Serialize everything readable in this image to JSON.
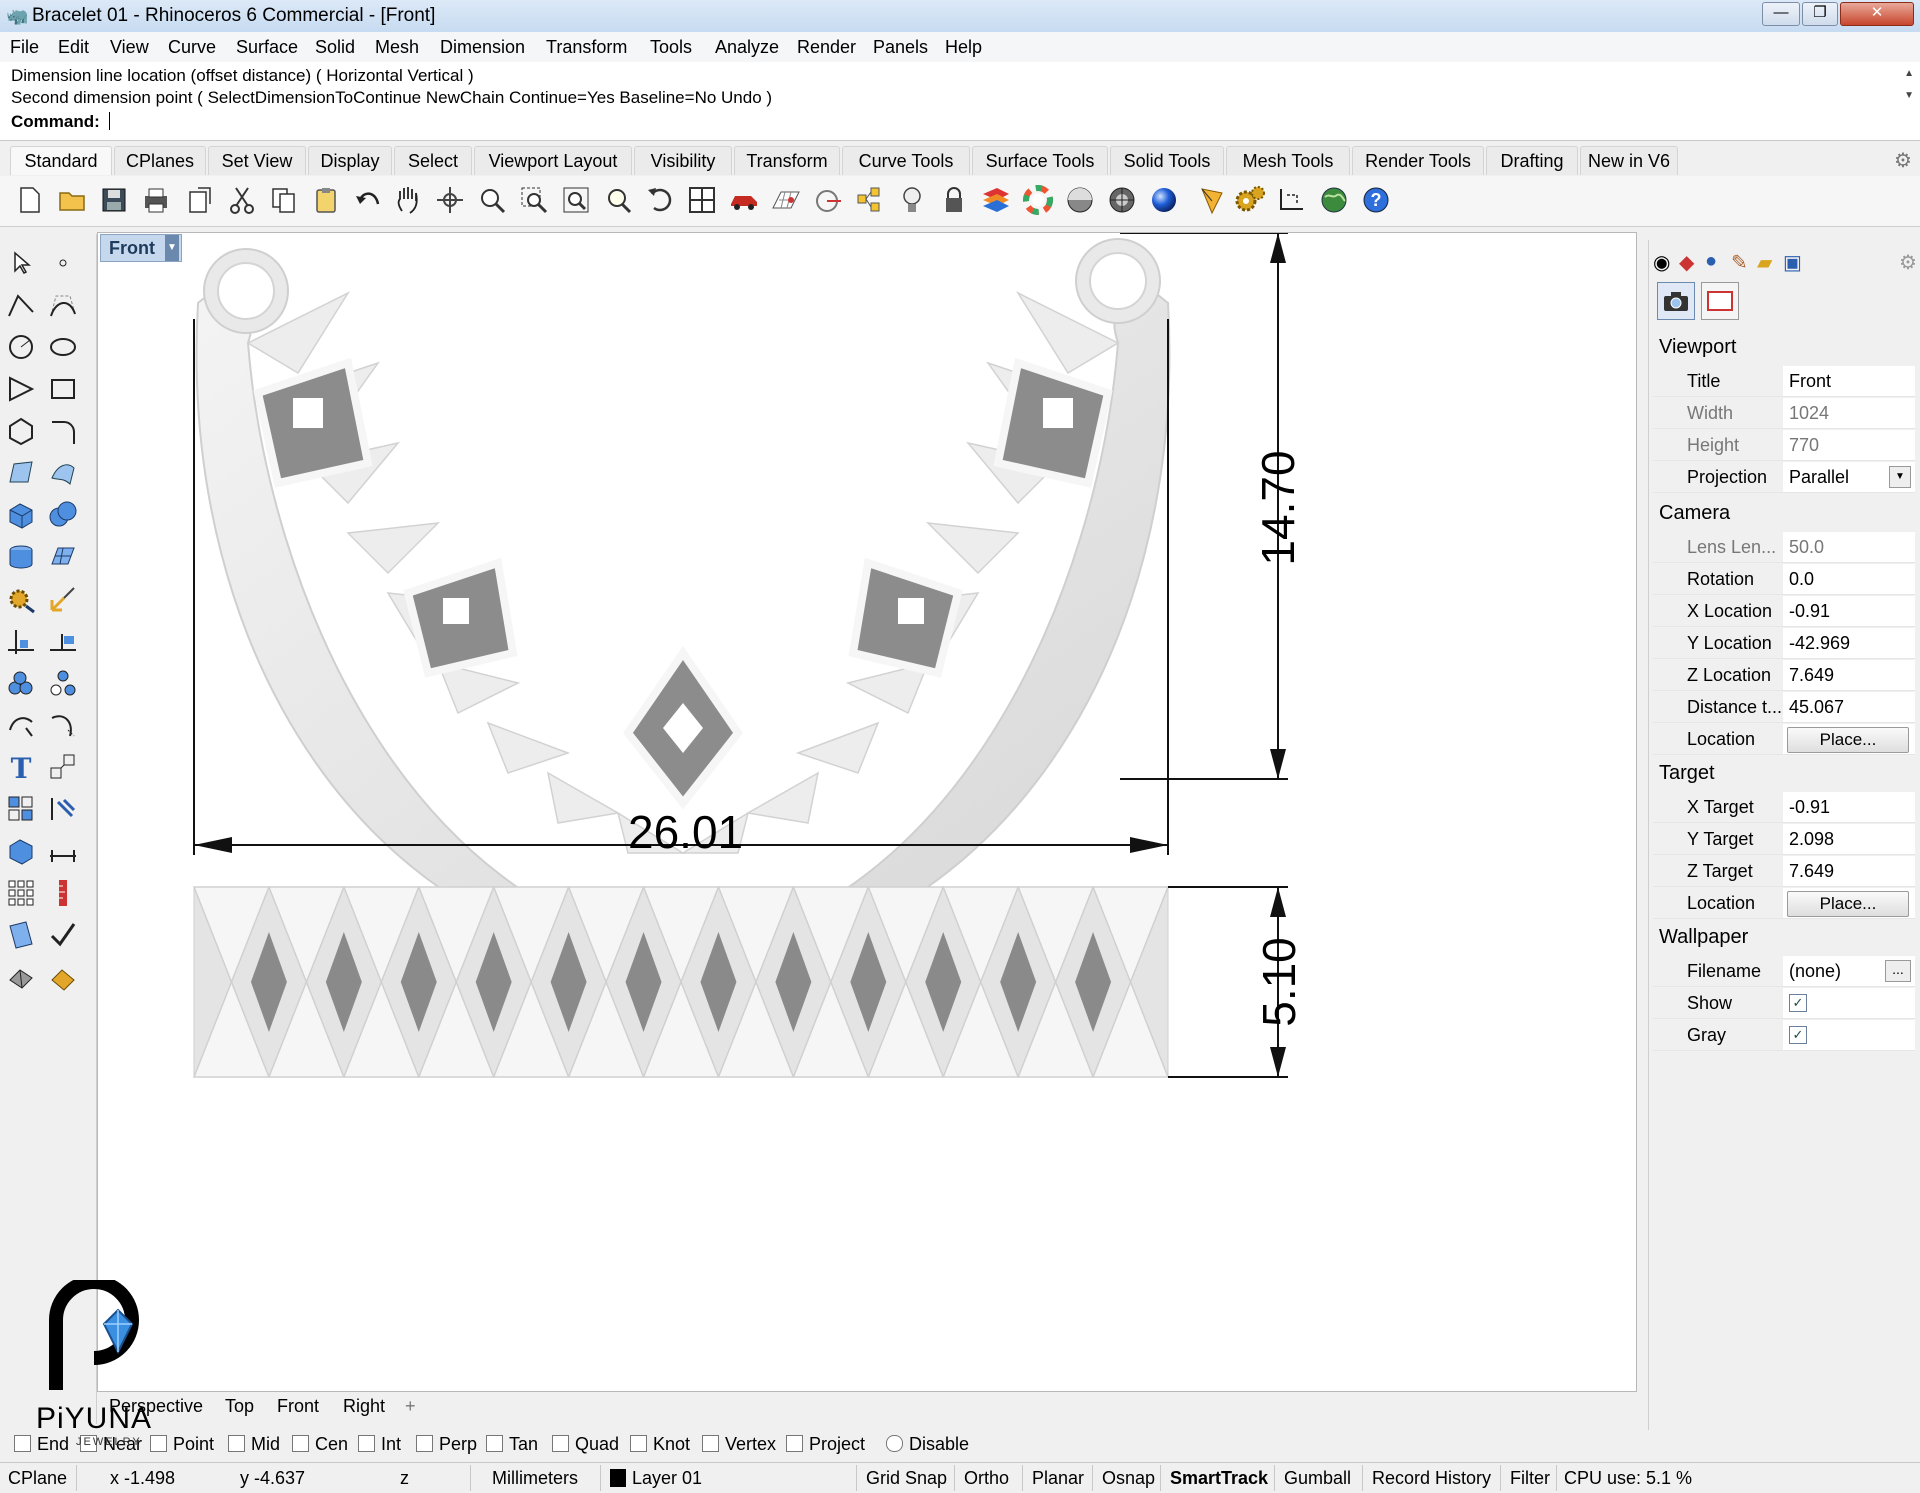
{
  "window": {
    "title": "Bracelet 01 - Rhinoceros 6 Commercial - [Front]",
    "minimize": "—",
    "restore": "❐",
    "close": "✕"
  },
  "menu": [
    "File",
    "Edit",
    "View",
    "Curve",
    "Surface",
    "Solid",
    "Mesh",
    "Dimension",
    "Transform",
    "Tools",
    "Analyze",
    "Render",
    "Panels",
    "Help"
  ],
  "command": {
    "history_line1": "Dimension line location (offset distance) ( Horizontal  Vertical )",
    "history_line2": "Second dimension point ( SelectDimensionToContinue  NewChain  Continue=Yes  Baseline=No  Undo )",
    "prompt_label": "Command:",
    "input_value": ""
  },
  "toolbar_tabs": [
    "Standard",
    "CPlanes",
    "Set View",
    "Display",
    "Select",
    "Viewport Layout",
    "Visibility",
    "Transform",
    "Curve Tools",
    "Surface Tools",
    "Solid Tools",
    "Mesh Tools",
    "Render Tools",
    "Drafting",
    "New in V6"
  ],
  "toolbar_icons": [
    "new-icon",
    "open-icon",
    "save-icon",
    "print-icon",
    "import-icon",
    "cut-icon",
    "copy-icon",
    "paste-icon",
    "undo-icon",
    "pan-icon",
    "rotate-icon",
    "zoom-icon",
    "zoom-window-icon",
    "zoom-extents-icon",
    "zoom-selected-icon",
    "rotate-view-icon",
    "four-viewports-icon",
    "car-icon",
    "grid-icon",
    "cplane-icon",
    "osnap-icon",
    "light-icon",
    "lock-icon",
    "layer-icon",
    "color-wheel-icon",
    "shaded-sphere-icon",
    "render-sphere-icon",
    "blue-sphere-icon",
    "pen-icon",
    "settings-icon",
    "dimension-icon",
    "earth-icon",
    "help-icon"
  ],
  "viewport": {
    "label": "Front",
    "dimensions": {
      "width": "26.01",
      "height_top": "14.70",
      "height_bottom": "5.10"
    }
  },
  "viewport_tabs": [
    "Perspective",
    "Top",
    "Front",
    "Right"
  ],
  "properties": {
    "section_viewport": "Viewport",
    "title_label": "Title",
    "title_value": "Front",
    "width_label": "Width",
    "width_value": "1024",
    "height_label": "Height",
    "height_value": "770",
    "projection_label": "Projection",
    "projection_value": "Parallel",
    "section_camera": "Camera",
    "lens_label": "Lens Len...",
    "lens_value": "50.0",
    "rotation_label": "Rotation",
    "rotation_value": "0.0",
    "xloc_label": "X Location",
    "xloc_value": "-0.91",
    "yloc_label": "Y Location",
    "yloc_value": "-42.969",
    "zloc_label": "Z Location",
    "zloc_value": "7.649",
    "dist_label": "Distance t...",
    "dist_value": "45.067",
    "location_label": "Location",
    "place_button": "Place...",
    "section_target": "Target",
    "xtgt_label": "X Target",
    "xtgt_value": "-0.91",
    "ytgt_label": "Y Target",
    "ytgt_value": "2.098",
    "ztgt_label": "Z Target",
    "ztgt_value": "7.649",
    "tloc_label": "Location",
    "tplace_button": "Place...",
    "section_wallpaper": "Wallpaper",
    "filename_label": "Filename",
    "filename_value": "(none)",
    "browse_button": "...",
    "show_label": "Show",
    "show_checked": true,
    "gray_label": "Gray",
    "gray_checked": true
  },
  "osnaps": [
    "End",
    "Near",
    "Point",
    "Mid",
    "Cen",
    "Int",
    "Perp",
    "Tan",
    "Quad",
    "Knot",
    "Vertex",
    "Project"
  ],
  "osnap_disable": "Disable",
  "status": {
    "cplane": "CPlane",
    "x": "x -1.498",
    "y": "y -4.637",
    "z": "z",
    "units": "Millimeters",
    "layer": "Layer 01",
    "layer_color": "#000000",
    "grid_snap": "Grid Snap",
    "ortho": "Ortho",
    "planar": "Planar",
    "osnap": "Osnap",
    "smarttrack": "SmartTrack",
    "gumball": "Gumball",
    "record_history": "Record History",
    "filter": "Filter",
    "cpu": "CPU use: 5.1 %"
  },
  "logo": {
    "brand": "PiYUNA",
    "tagline": "JEWELRY"
  },
  "colors": {
    "accent": "#1f5ea8",
    "model": "#ececec",
    "model_shadow": "#8a8a8a"
  }
}
